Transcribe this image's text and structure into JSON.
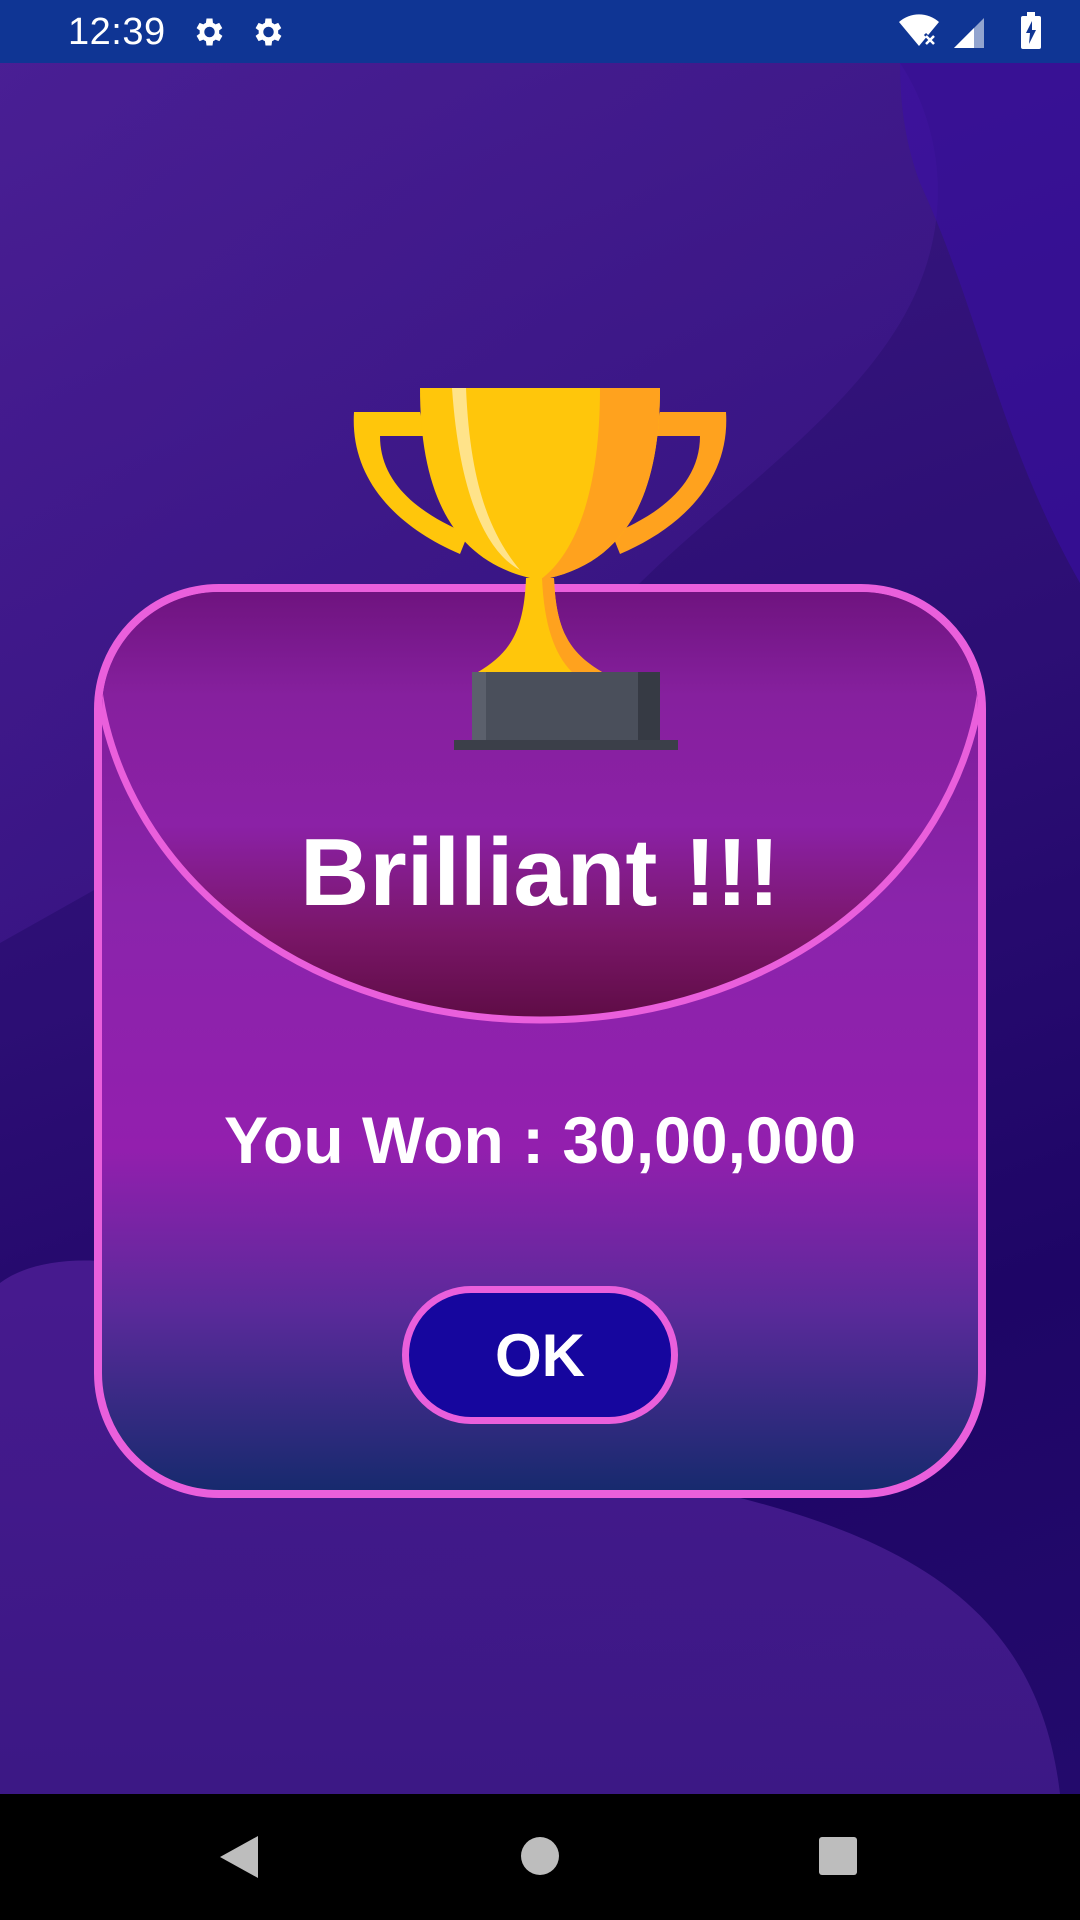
{
  "status_bar": {
    "time": "12:39",
    "icons": [
      "gear-icon",
      "gear-icon",
      "wifi-icon",
      "signal-icon",
      "battery-icon"
    ]
  },
  "dialog": {
    "headline": "Brilliant !!!",
    "won_label": "You Won : ",
    "won_amount": "30,00,000",
    "ok_label": "OK",
    "icon": "trophy-icon"
  },
  "nav_bar": {
    "icons": [
      "back-icon",
      "home-icon",
      "recents-icon"
    ]
  },
  "colors": {
    "status_bar": "#0f3594",
    "background": "#2c0e74",
    "dialog_border": "#ea5fdc",
    "button_fill": "#16069e",
    "trophy_gold": "#ffc60b",
    "trophy_base": "#4a4f5b"
  }
}
